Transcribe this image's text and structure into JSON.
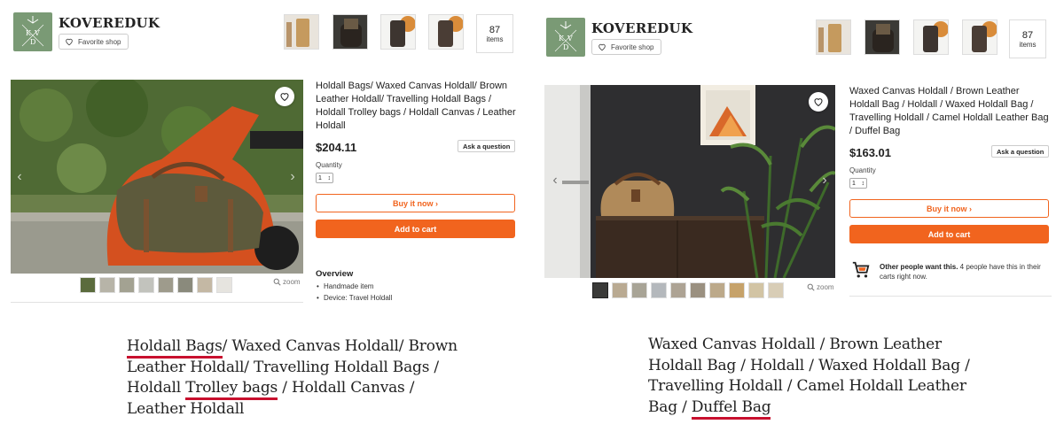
{
  "left": {
    "shop_name": "KOVEREDUK",
    "favorite_label": "Favorite shop",
    "items_count": "87",
    "items_label": "items",
    "product_title": "Holdall Bags/ Waxed Canvas Holdall/ Brown Leather Holdall/ Travelling Holdall Bags / Holdall Trolley bags / Holdall Canvas / Leather Holdall",
    "price": "$204.11",
    "ask_label": "Ask a question",
    "quantity_label": "Quantity",
    "quantity_value": "1",
    "buy_label": "Buy it now",
    "cart_label": "Add to cart",
    "zoom_label": "zoom",
    "overview_title": "Overview",
    "overview_items": [
      "Handmade item",
      "Device: Travel Holdall"
    ],
    "caption": {
      "line1_a": "Holdall Bags",
      "line1_b": "/ Waxed Canvas Holdall/ Brown",
      "line2": "Leather Holdall/ Travelling Holdall Bags /",
      "line3_a": "Holdall ",
      "line3_b": "Trolley bags",
      "line3_c": " / Holdall Canvas /",
      "line4": "Leather Holdall"
    }
  },
  "right": {
    "shop_name": "KOVEREDUK",
    "favorite_label": "Favorite shop",
    "items_count": "87",
    "items_label": "items",
    "product_title": "Waxed Canvas Holdall / Brown Leather Holdall Bag / Holdall / Waxed Holdall Bag / Travelling Holdall / Camel Holdall Leather Bag / Duffel Bag",
    "price": "$163.01",
    "ask_label": "Ask a question",
    "quantity_label": "Quantity",
    "quantity_value": "1",
    "buy_label": "Buy it now",
    "cart_label": "Add to cart",
    "zoom_label": "zoom",
    "notice_bold": "Other people want this.",
    "notice_rest": " 4 people have this in their carts right now.",
    "caption": {
      "line1": "Waxed Canvas Holdall / Brown Leather",
      "line2": "Holdall Bag / Holdall / Waxed Holdall Bag /",
      "line3": "Travelling Holdall / Camel Holdall Leather",
      "line4_a": "Bag / ",
      "line4_b": "Duffel Bag"
    }
  },
  "colors": {
    "accent": "#f1641e",
    "underline": "#c8102e",
    "logo_bg": "#7a9a75"
  }
}
